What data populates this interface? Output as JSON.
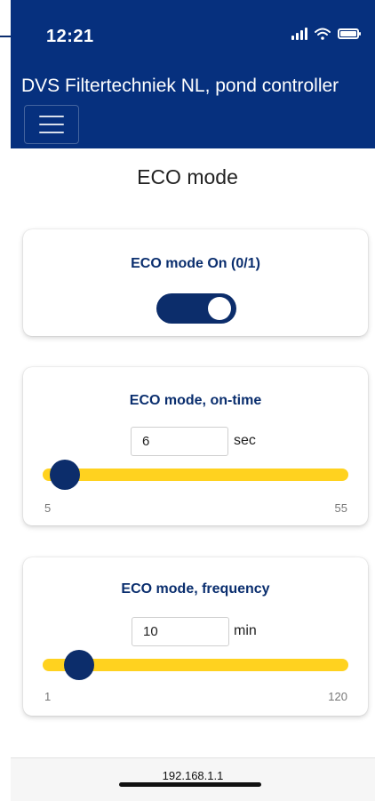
{
  "status_bar": {
    "time": "12:21",
    "signal_icon": "cellular-signal-icon",
    "wifi_icon": "wifi-icon",
    "battery_icon": "battery-icon"
  },
  "header": {
    "title": "DVS Filtertechniek NL, pond controller",
    "menu_icon": "hamburger-menu-icon",
    "background_color": "#06307e"
  },
  "page": {
    "title": "ECO mode"
  },
  "eco_toggle": {
    "label": "ECO mode On (0/1)",
    "value": true,
    "color": "#0c2d6b"
  },
  "on_time": {
    "label": "ECO mode, on-time",
    "value": "6",
    "unit": "sec",
    "min": "5",
    "max": "55",
    "track_color": "#ffd21f"
  },
  "frequency": {
    "label": "ECO mode, frequency",
    "value": "10",
    "unit": "min",
    "min": "1",
    "max": "120",
    "track_color": "#ffd21f"
  },
  "browser": {
    "url": "192.168.1.1"
  }
}
